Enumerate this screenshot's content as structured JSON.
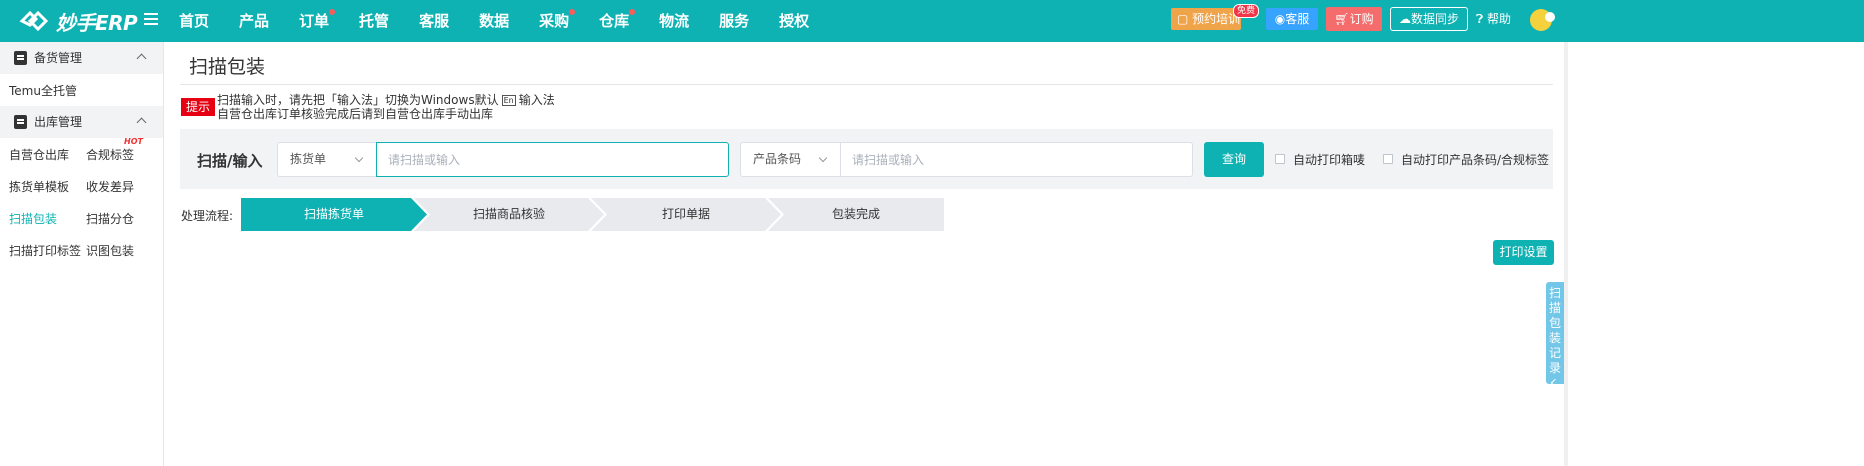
{
  "brand": {
    "name": "妙手ERP"
  },
  "nav": [
    {
      "label": "首页",
      "dot": false
    },
    {
      "label": "产品",
      "dot": false
    },
    {
      "label": "订单",
      "dot": true
    },
    {
      "label": "托管",
      "dot": false
    },
    {
      "label": "客服",
      "dot": false
    },
    {
      "label": "数据",
      "dot": false
    },
    {
      "label": "采购",
      "dot": true
    },
    {
      "label": "仓库",
      "dot": true
    },
    {
      "label": "物流",
      "dot": false
    },
    {
      "label": "服务",
      "dot": false
    },
    {
      "label": "授权",
      "dot": false
    }
  ],
  "header_actions": {
    "training": "预约培训",
    "free_tag": "免费",
    "service": "客服",
    "order": "订购",
    "sync": "数据同步",
    "help": "帮助"
  },
  "sidebar": {
    "group1": {
      "title": "备货管理",
      "items": [
        "Temu全托管"
      ]
    },
    "group2": {
      "title": "出库管理",
      "items": [
        "自营仓出库",
        "合规标签",
        "拣货单模板",
        "收发差异",
        "扫描包装",
        "扫描分仓",
        "扫描打印标签",
        "识图包装"
      ],
      "hot_label": "HOT",
      "active": "扫描包装"
    }
  },
  "page": {
    "title": "扫描包装",
    "tip_badge": "提示",
    "tip_line1_pre": "扫描输入时，请先把「输入法」切换为Windows默认",
    "tip_en": "En",
    "tip_line1_post": "输入法",
    "tip_line2": "自营仓出库订单核验完成后请到自营仓出库手动出库"
  },
  "search": {
    "label": "扫描/输入",
    "select1": "拣货单",
    "input1_placeholder": "请扫描或输入",
    "select2": "产品条码",
    "input2_placeholder": "请扫描或输入",
    "query": "查询",
    "check1": "自动打印箱唛",
    "check2": "自动打印产品条码/合规标签"
  },
  "flow": {
    "label": "处理流程:",
    "steps": [
      "扫描拣货单",
      "扫描商品核验",
      "打印单据",
      "包装完成"
    ],
    "active_index": 0
  },
  "actions": {
    "print_settings": "打印设置",
    "record_tab": "扫描包装记录"
  },
  "colors": {
    "primary": "#0fb2b3",
    "danger": "#e60012",
    "step_inactive": "#e8eaee"
  }
}
